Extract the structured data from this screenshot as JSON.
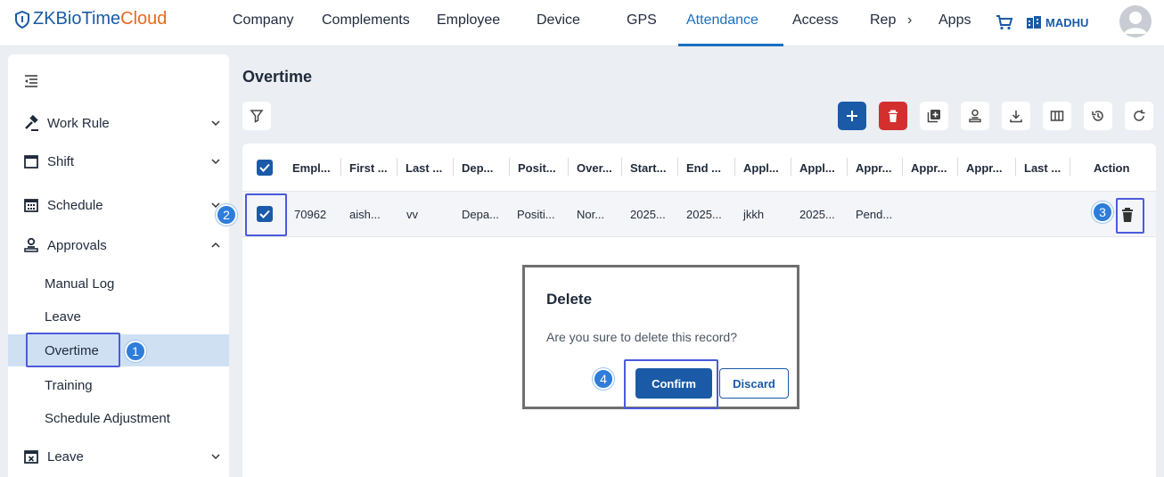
{
  "brand": {
    "part_a": "ZKBioTime",
    "part_b": "Cloud",
    "color_a": "#1a5aa6",
    "color_b": "#e86a1d"
  },
  "nav": {
    "items": [
      "Company",
      "Complements",
      "Employee",
      "Device",
      "GPS",
      "Attendance",
      "Access",
      "Rep",
      "Apps"
    ],
    "active": "Attendance",
    "more_glyph": "›",
    "user_name": "MADHU"
  },
  "sidebar": {
    "groups": [
      {
        "label": "Work Rule",
        "icon": "gavel-icon"
      },
      {
        "label": "Shift",
        "icon": "calendar-icon"
      },
      {
        "label": "Schedule",
        "icon": "calendar-grid-icon"
      },
      {
        "label": "Approvals",
        "icon": "user-stamp-icon"
      },
      {
        "label": "Leave",
        "icon": "calendar-x-icon"
      }
    ],
    "approvals_items": [
      "Manual Log",
      "Leave",
      "Overtime",
      "Training",
      "Schedule Adjustment"
    ],
    "active_item": "Overtime"
  },
  "page": {
    "title": "Overtime"
  },
  "table": {
    "headers": [
      "Empl...",
      "First ...",
      "Last ...",
      "Dep...",
      "Posit...",
      "Over...",
      "Start...",
      "End ...",
      "Appl...",
      "Appl...",
      "Appr...",
      "Appr...",
      "Appr...",
      "Last ...",
      "Action"
    ],
    "rows": [
      [
        "70962",
        "aish...",
        "vv",
        "Depa...",
        "Positi...",
        "Nor...",
        "2025...",
        "2025...",
        "jkkh",
        "2025...",
        "Pend...",
        "",
        "",
        ""
      ]
    ]
  },
  "dialog": {
    "title": "Delete",
    "message": "Are you sure to delete this record?",
    "confirm_label": "Confirm",
    "discard_label": "Discard"
  },
  "steps": [
    "1",
    "2",
    "3",
    "4"
  ],
  "colors": {
    "accent": "#1a5aa6",
    "danger": "#d32f2f",
    "highlight": "#4b5bdc",
    "step": "#2e7ddb"
  }
}
